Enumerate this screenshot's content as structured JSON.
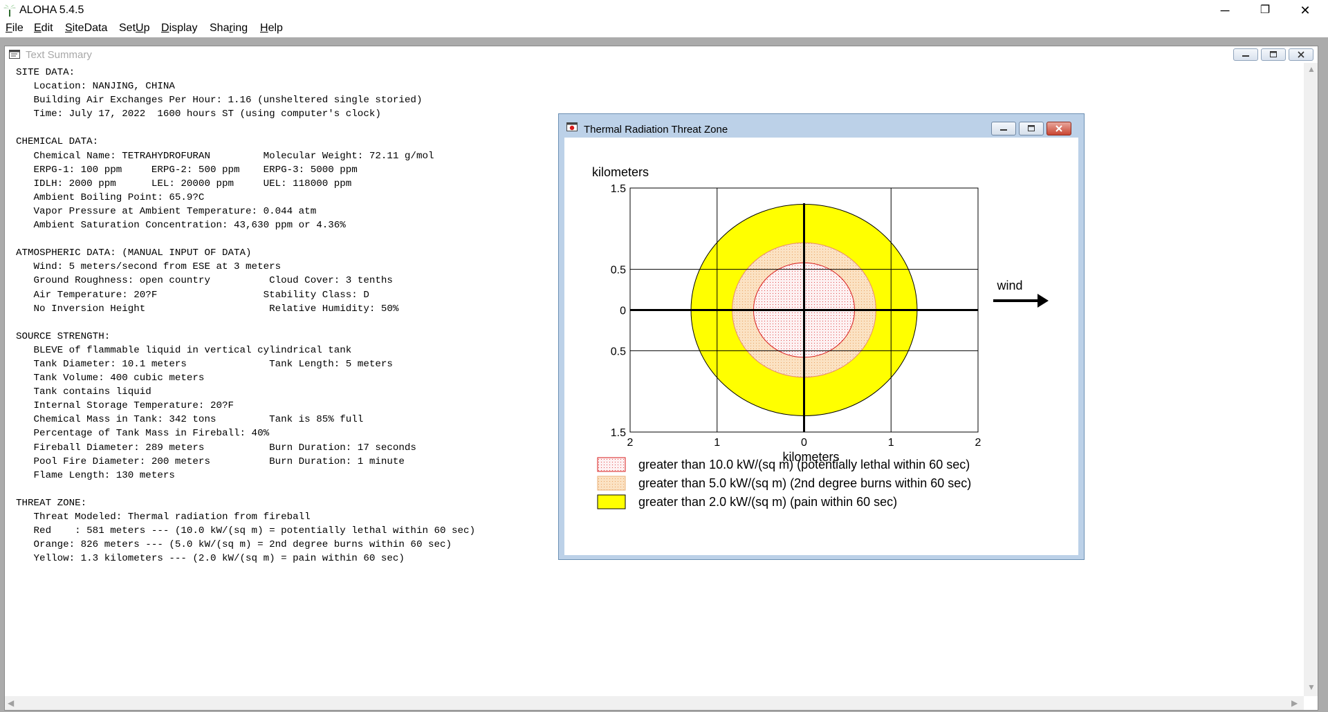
{
  "app": {
    "title": "ALOHA 5.4.5",
    "window_controls": [
      "─",
      "❐",
      "✕"
    ]
  },
  "menu": [
    {
      "underline": "F",
      "rest": "ile"
    },
    {
      "underline": "E",
      "rest": "dit"
    },
    {
      "underline": "S",
      "rest": "iteData"
    },
    {
      "pre": "Set",
      "underline": "U",
      "rest": "p"
    },
    {
      "underline": "D",
      "rest": "isplay"
    },
    {
      "pre": "Sha",
      "underline": "r",
      "rest": "ing"
    },
    {
      "underline": "H",
      "rest": "elp"
    }
  ],
  "text_summary": {
    "title": "Text Summary",
    "lines": [
      "SITE DATA:",
      "   Location: NANJING, CHINA",
      "   Building Air Exchanges Per Hour: 1.16 (unsheltered single storied)",
      "   Time: July 17, 2022  1600 hours ST (using computer's clock)",
      "",
      "CHEMICAL DATA:",
      "   Chemical Name: TETRAHYDROFURAN         Molecular Weight: 72.11 g/mol",
      "   ERPG-1: 100 ppm     ERPG-2: 500 ppm    ERPG-3: 5000 ppm",
      "   IDLH: 2000 ppm      LEL: 20000 ppm     UEL: 118000 ppm",
      "   Ambient Boiling Point: 65.9?C",
      "   Vapor Pressure at Ambient Temperature: 0.044 atm",
      "   Ambient Saturation Concentration: 43,630 ppm or 4.36%",
      "",
      "ATMOSPHERIC DATA: (MANUAL INPUT OF DATA)",
      "   Wind: 5 meters/second from ESE at 3 meters",
      "   Ground Roughness: open country          Cloud Cover: 3 tenths",
      "   Air Temperature: 20?F                  Stability Class: D",
      "   No Inversion Height                     Relative Humidity: 50%",
      "",
      "SOURCE STRENGTH:",
      "   BLEVE of flammable liquid in vertical cylindrical tank",
      "   Tank Diameter: 10.1 meters              Tank Length: 5 meters",
      "   Tank Volume: 400 cubic meters",
      "   Tank contains liquid",
      "   Internal Storage Temperature: 20?F",
      "   Chemical Mass in Tank: 342 tons         Tank is 85% full",
      "   Percentage of Tank Mass in Fireball: 40%",
      "   Fireball Diameter: 289 meters           Burn Duration: 17 seconds",
      "   Pool Fire Diameter: 200 meters          Burn Duration: 1 minute",
      "   Flame Length: 130 meters",
      "",
      "THREAT ZONE:",
      "   Threat Modeled: Thermal radiation from fireball",
      "   Red    : 581 meters --- (10.0 kW/(sq m) = potentially lethal within 60 sec)",
      "   Orange: 826 meters --- (5.0 kW/(sq m) = 2nd degree burns within 60 sec)",
      "   Yellow: 1.3 kilometers --- (2.0 kW/(sq m) = pain within 60 sec)"
    ]
  },
  "threat_window": {
    "title": "Thermal Radiation Threat Zone"
  },
  "chart_data": {
    "type": "threat-zone-plot",
    "ylabel_top": "kilometers",
    "xlabel": "kilometers",
    "xlim": [
      -2,
      2
    ],
    "ylim": [
      -1.5,
      1.5
    ],
    "x_ticks": [
      {
        "value": -2,
        "label": "2"
      },
      {
        "value": -1,
        "label": "1"
      },
      {
        "value": 0,
        "label": "0"
      },
      {
        "value": 1,
        "label": "1"
      },
      {
        "value": 2,
        "label": "2"
      }
    ],
    "y_ticks": [
      {
        "value": 1.5,
        "label": "1.5"
      },
      {
        "value": 0.5,
        "label": "0.5"
      },
      {
        "value": 0,
        "label": "0"
      },
      {
        "value": -0.5,
        "label": "0.5"
      },
      {
        "value": -1.5,
        "label": "1.5"
      }
    ],
    "grid_x": [
      -1,
      1
    ],
    "grid_y": [
      0.5,
      -0.5
    ],
    "zones": [
      {
        "name": "greater than 2.0 kW/(sq m) (pain within 60 sec)",
        "radius_km": 1.3,
        "color": "#ffff00",
        "edge": "#000000",
        "pattern": "solid"
      },
      {
        "name": "greater than 5.0 kW/(sq m) (2nd degree burns within 60 sec)",
        "radius_km": 0.826,
        "color": "#fad9b3",
        "edge": "#e88a6e",
        "pattern": "dotted"
      },
      {
        "name": "greater than 10.0 kW/(sq m) (potentially lethal within 60 sec)",
        "radius_km": 0.581,
        "color": "#fbe7ea",
        "edge": "#d81b1b",
        "pattern": "dotted"
      }
    ],
    "legend": [
      {
        "label": "greater than 10.0 kW/(sq m) (potentially lethal within 60 sec)",
        "color": "#fbe7ea",
        "edge": "#d81b1b"
      },
      {
        "label": "greater than 5.0 kW/(sq m) (2nd degree burns within 60 sec)",
        "color": "#fad9b3",
        "edge": "#e8b07a"
      },
      {
        "label": "greater than 2.0 kW/(sq m) (pain within 60 sec)",
        "color": "#ffff00",
        "edge": "#000000"
      }
    ],
    "wind_label": "wind",
    "wind_direction": "right"
  }
}
